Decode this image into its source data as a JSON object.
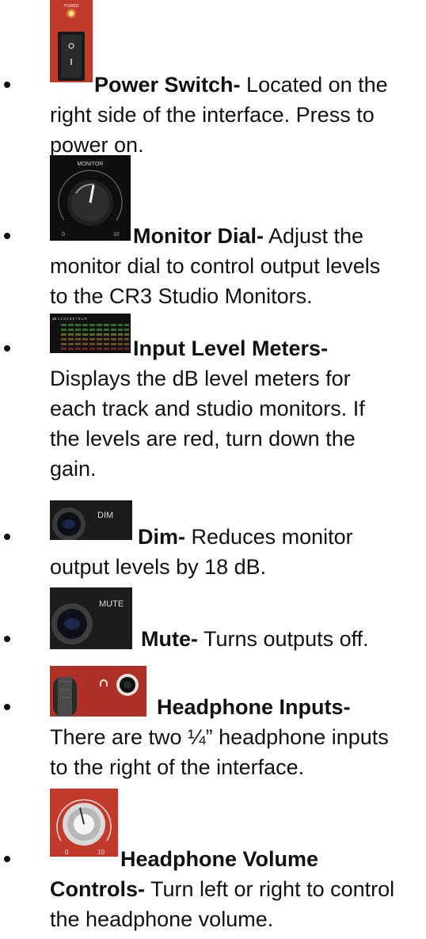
{
  "items": [
    {
      "term": "Power Switch-",
      "lines": [
        "Located on the",
        "right side of the interface. Press to",
        "power on."
      ],
      "image_text": "POWER"
    },
    {
      "term": "Monitor Dial-",
      "lines": [
        "Adjust the",
        "monitor dial to control output levels",
        "to the CR3 Studio Monitors."
      ],
      "image_text": "MONITOR",
      "image_scale": [
        "0",
        "10"
      ]
    },
    {
      "term": "Input Level Meters",
      "term_suffix": "-",
      "lines": [
        "Displays the dB level meters for",
        "each track and studio monitors. If",
        "the levels are red, turn down the",
        "gain."
      ],
      "image_text": "dB 1 2 3 4 5 6 7 8 L R"
    },
    {
      "term": "Dim-",
      "lines": [
        "Reduces monitor",
        "output levels by 18 dB."
      ],
      "image_text": "DIM"
    },
    {
      "term": "Mute-",
      "lines": [
        "Turns outputs off."
      ],
      "image_text": "MUTE"
    },
    {
      "term": "Headphone Inputs-",
      "lines": [
        "There are two ¼” headphone inputs",
        "to the right of the interface."
      ]
    },
    {
      "term": "Headphone Volume",
      "term_line2": "Controls-",
      "lines": [
        "Turn left or right to control",
        "the headphone volume."
      ],
      "image_scale": [
        "0",
        "10"
      ]
    }
  ],
  "colors": {
    "text": "#111111",
    "interface_red": "#c23a2c",
    "panel_black": "#141414"
  },
  "icons": [
    "power-switch-photo",
    "monitor-dial-photo",
    "level-meters-photo",
    "dim-button-photo",
    "mute-button-photo",
    "headphone-jack-photo",
    "headphone-volume-knob-photo"
  ]
}
